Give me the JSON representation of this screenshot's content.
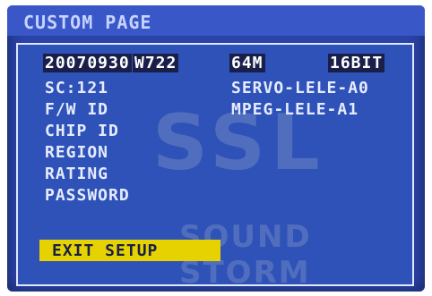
{
  "header": {
    "title": "CUSTOM PAGE"
  },
  "info": {
    "date": "20070930",
    "build": "W722",
    "memory": "64M",
    "bit": "16BIT",
    "sc": "SC:121",
    "fw_label": "F/W ID",
    "servo": "SERVO-LELE-A0",
    "mpeg": "MPEG-LELE-A1",
    "chip_label": "CHIP ID",
    "region_label": "REGION",
    "rating_label": "RATING",
    "password_label": "PASSWORD"
  },
  "exit_label": "EXIT SETUP",
  "watermark": {
    "big": "SSL",
    "sub": "SOUND STORM"
  },
  "colors": {
    "background": "#2b43a8",
    "header": "#3a57c8",
    "panel": "#2f52b8",
    "highlight": "#e6d200",
    "text": "#e6ecff"
  }
}
